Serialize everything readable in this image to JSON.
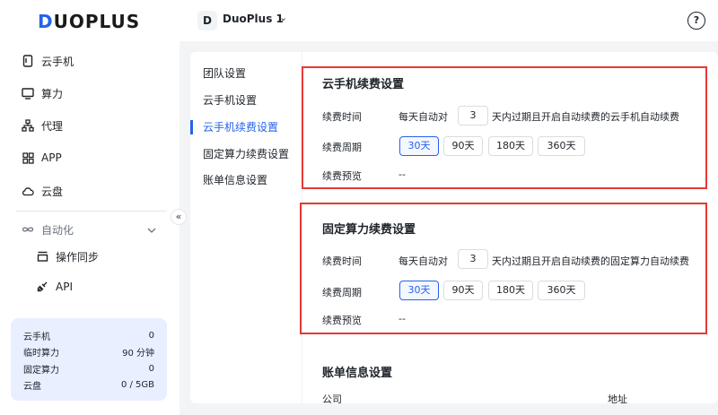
{
  "app": {
    "logo_prefix": "D",
    "logo_rest": "UOPLUS"
  },
  "sidebar": {
    "items": [
      {
        "label": "云手机",
        "icon": "phone-icon"
      },
      {
        "label": "算力",
        "icon": "monitor-icon"
      },
      {
        "label": "代理",
        "icon": "network-icon"
      },
      {
        "label": "APP",
        "icon": "apps-grid-icon"
      },
      {
        "label": "云盘",
        "icon": "cloud-icon"
      }
    ],
    "group": {
      "label": "自动化",
      "icon": "infinity-icon"
    },
    "sub_items": [
      {
        "label": "操作同步",
        "icon": "sync-icon"
      },
      {
        "label": "API",
        "icon": "api-icon"
      }
    ],
    "collapse_icon": "«"
  },
  "stats": [
    {
      "label": "云手机",
      "value": "0"
    },
    {
      "label": "临时算力",
      "value": "90 分钟"
    },
    {
      "label": "固定算力",
      "value": "0"
    },
    {
      "label": "云盘",
      "value": "0 / 5GB"
    }
  ],
  "header": {
    "team_initial": "D",
    "team_name": "DuoPlus 1",
    "team_chevron": "⌄",
    "help_icon": "?"
  },
  "settings_nav": [
    {
      "label": "团队设置",
      "active": false
    },
    {
      "label": "云手机设置",
      "active": false
    },
    {
      "label": "云手机续费设置",
      "active": true
    },
    {
      "label": "固定算力续费设置",
      "active": false
    },
    {
      "label": "账单信息设置",
      "active": false
    }
  ],
  "cloud_phone_renewal": {
    "title": "云手机续费设置",
    "time_label": "续费时间",
    "time_prefix": "每天自动对",
    "time_days": "3",
    "time_suffix": "天内过期且开启自动续费的云手机自动续费",
    "period_label": "续费周期",
    "period_options": [
      "30天",
      "90天",
      "180天",
      "360天"
    ],
    "selected_period": "30天",
    "preview_label": "续费预览",
    "preview_value": "--"
  },
  "fixed_compute_renewal": {
    "title": "固定算力续费设置",
    "time_label": "续费时间",
    "time_prefix": "每天自动对",
    "time_days": "3",
    "time_suffix": "天内过期且开启自动续费的固定算力自动续费",
    "period_label": "续费周期",
    "period_options": [
      "30天",
      "90天",
      "180天",
      "360天"
    ],
    "selected_period": "30天",
    "preview_label": "续费预览",
    "preview_value": "--"
  },
  "billing_info": {
    "title": "账单信息设置",
    "company_label": "公司",
    "address_label": "地址"
  },
  "colors": {
    "accent": "#2563eb",
    "highlight_border": "#e53935",
    "stats_bg": "#e8efff"
  }
}
